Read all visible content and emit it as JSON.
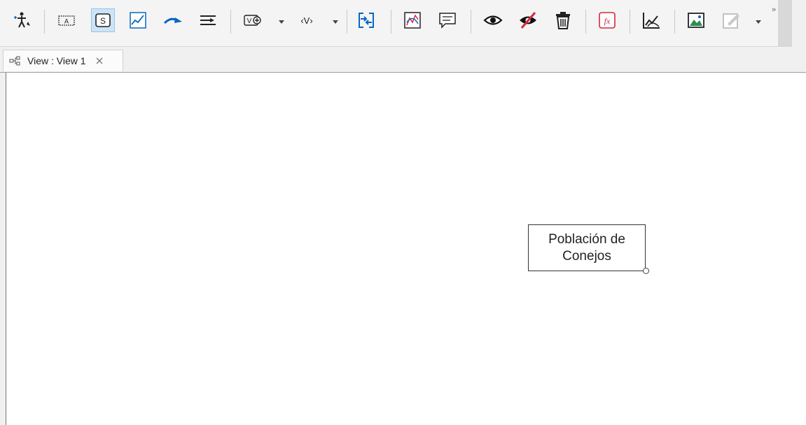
{
  "toolbar": {
    "overflow": "»",
    "buttons": [
      {
        "name": "pointer-tool-icon"
      },
      {
        "name": "auxiliary-variable-icon",
        "label": "A"
      },
      {
        "name": "stock-variable-icon",
        "label": "S"
      },
      {
        "name": "graphical-function-icon"
      },
      {
        "name": "flow-connector-icon"
      },
      {
        "name": "align-icon"
      },
      {
        "name": "new-variable-icon",
        "label": "V"
      },
      {
        "name": "shadow-variable-icon",
        "label": "‹V›"
      },
      {
        "name": "connect-views-icon"
      },
      {
        "name": "chart-icon"
      },
      {
        "name": "comment-icon"
      },
      {
        "name": "show-icon"
      },
      {
        "name": "hide-icon"
      },
      {
        "name": "delete-icon"
      },
      {
        "name": "equation-icon",
        "label": "fx"
      },
      {
        "name": "analyze-icon"
      },
      {
        "name": "image-icon"
      },
      {
        "name": "edit-shape-icon"
      }
    ],
    "accent": "#0a66c2",
    "active_color": "#cde4f7"
  },
  "tab": {
    "title": "View : View 1",
    "close": "×"
  },
  "canvas": {
    "stock": {
      "line1": "Población de",
      "line2": "Conejos"
    }
  }
}
